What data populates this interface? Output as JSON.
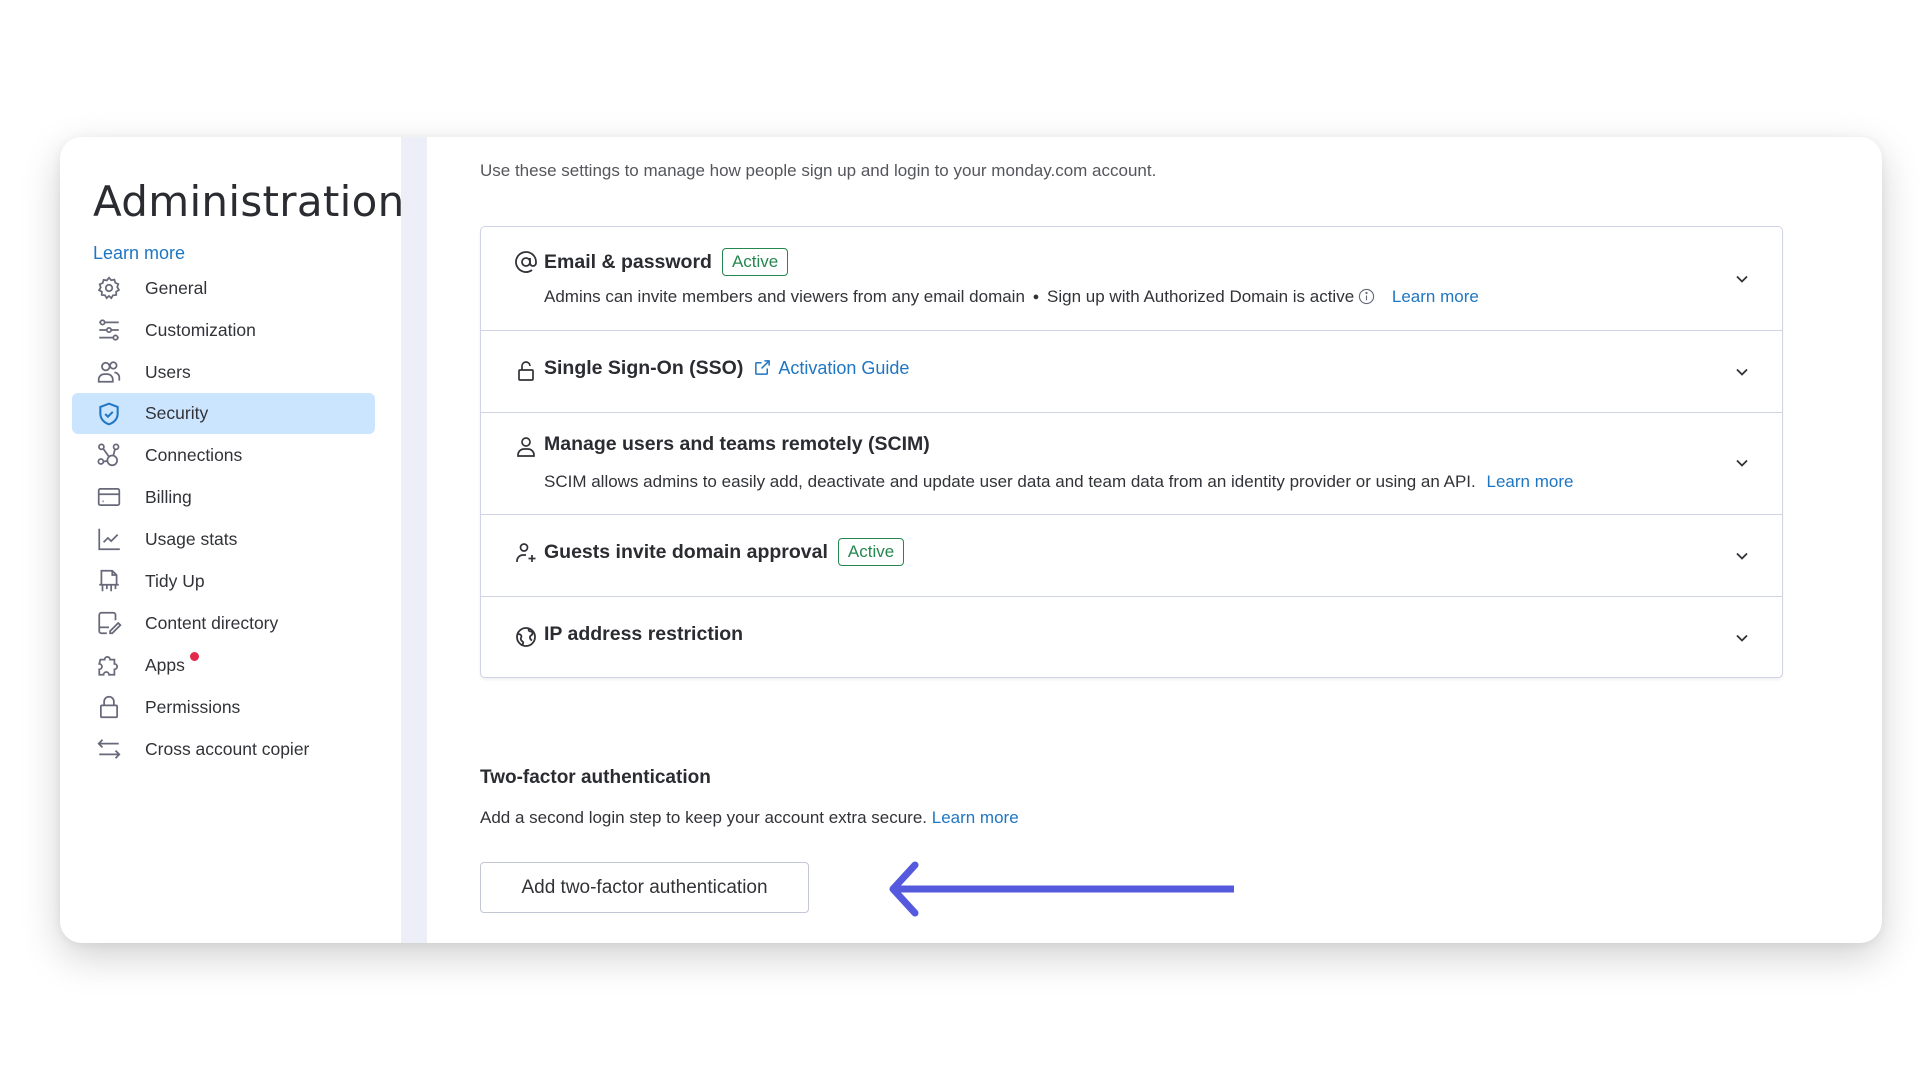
{
  "sidebar": {
    "title": "Administration",
    "learn_more": "Learn more",
    "items": [
      {
        "label": "General",
        "icon": "gear-icon"
      },
      {
        "label": "Customization",
        "icon": "sliders-icon"
      },
      {
        "label": "Users",
        "icon": "users-icon"
      },
      {
        "label": "Security",
        "icon": "shield-check-icon",
        "active": true
      },
      {
        "label": "Connections",
        "icon": "connections-icon"
      },
      {
        "label": "Billing",
        "icon": "credit-card-icon"
      },
      {
        "label": "Usage stats",
        "icon": "chart-line-icon"
      },
      {
        "label": "Tidy Up",
        "icon": "shredder-icon"
      },
      {
        "label": "Content directory",
        "icon": "document-edit-icon"
      },
      {
        "label": "Apps",
        "icon": "puzzle-icon",
        "notification_dot": true
      },
      {
        "label": "Permissions",
        "icon": "lock-icon"
      },
      {
        "label": "Cross account copier",
        "icon": "arrows-swap-icon"
      }
    ]
  },
  "main": {
    "intro": "Use these settings to manage how people sign up and login to your monday.com account.",
    "sections": [
      {
        "title": "Email & password",
        "icon": "at-sign-icon",
        "badge": "Active",
        "desc_part1": "Admins can invite members and viewers from any email domain",
        "desc_bullet": "●",
        "desc_part2": "Sign up with Authorized Domain is active",
        "link": "Learn more"
      },
      {
        "title": "Single Sign-On (SSO)",
        "icon": "unlock-icon",
        "link": "Activation Guide"
      },
      {
        "title": "Manage users and teams remotely (SCIM)",
        "icon": "user-icon",
        "desc": "SCIM allows admins to easily add, deactivate and update user data and team data from an identity provider or using an API.",
        "link": "Learn more"
      },
      {
        "title": "Guests invite domain approval",
        "icon": "user-plus-icon",
        "badge": "Active"
      },
      {
        "title": "IP address restriction",
        "icon": "globe-icon"
      }
    ],
    "two_factor": {
      "title": "Two-factor authentication",
      "desc": "Add a second login step to keep your account extra secure.",
      "link": "Learn more",
      "button": "Add two-factor authentication"
    }
  },
  "colors": {
    "accent_link": "#1f76c2",
    "active_badge": "#258750",
    "selected_nav": "#cce5ff",
    "annotation_arrow": "#5459de",
    "notification_dot": "#e2294a"
  }
}
